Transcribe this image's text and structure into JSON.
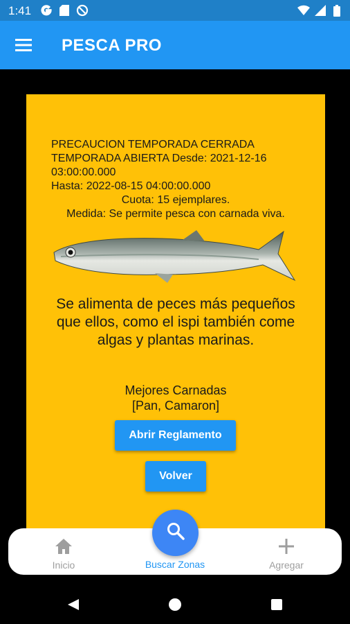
{
  "status_bar": {
    "time": "1:41",
    "icons_left": [
      "google-icon",
      "sd-card-icon",
      "sync-disabled-icon"
    ],
    "icons_right": [
      "wifi-icon",
      "signal-icon",
      "battery-icon"
    ]
  },
  "app_bar": {
    "title": "PESCA PRO",
    "menu_icon": "hamburger-menu-icon"
  },
  "colors": {
    "app_bar": "#2196f3",
    "status_bar": "#1f80c8",
    "card": "#ffc107",
    "button": "#2196f3",
    "fab": "#3d86f5"
  },
  "info": {
    "line1": "PRECAUCION TEMPORADA CERRADA",
    "line2": "TEMPORADA ABIERTA Desde: 2021-12-16",
    "line3": "03:00:00.000",
    "line4": "Hasta: 2022-08-15 04:00:00.000",
    "line5": "Cuota: 15 ejemplares.",
    "line6": "Medida: Se permite pesca con carnada viva."
  },
  "fish_image": "fish-photo",
  "description": "Se alimenta de peces más pequeños que ellos, como el ispi también come algas y plantas marinas.",
  "baits": {
    "title": "Mejores Carnadas",
    "list": "[Pan, Camaron]"
  },
  "buttons": {
    "reglamento": "Abrir Reglamento",
    "volver": "Volver"
  },
  "bottom_nav": {
    "inicio": "Inicio",
    "buscar": "Buscar Zonas",
    "agregar": "Agregar"
  },
  "system_nav": [
    "back-icon",
    "home-icon",
    "recents-icon"
  ]
}
